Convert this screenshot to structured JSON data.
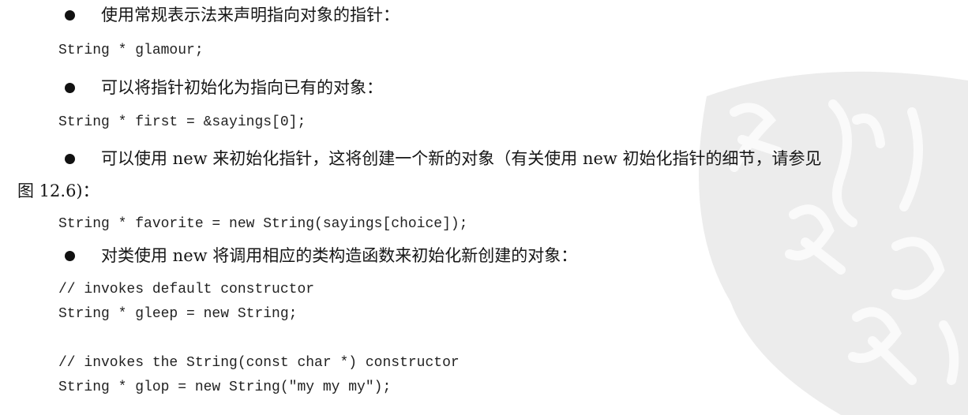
{
  "bullets": [
    {
      "text": "使用常规表示法来声明指向对象的指针："
    },
    {
      "text": "可以将指针初始化为指向已有的对象："
    },
    {
      "text": "可以使用 new 来初始化指针，这将创建一个新的对象（有关使用 new 初始化指针的细节，请参见",
      "continuation": "图 12.6)："
    },
    {
      "text": "对类使用 new 将调用相应的类构造函数来初始化新创建的对象："
    }
  ],
  "code": {
    "line1": "String * glamour;",
    "line2": "String * first = &sayings[0];",
    "line3": "String * favorite = new String(sayings[choice]);",
    "line4": "// invokes default constructor",
    "line5": "String * gleep = new String;",
    "line6": "// invokes the String(const char *) constructor",
    "line7": "String * glop = new String(\"my my my\");"
  },
  "watermark": {
    "icon": "calligraphy-seal-watermark",
    "color": "#e9e9e9"
  }
}
